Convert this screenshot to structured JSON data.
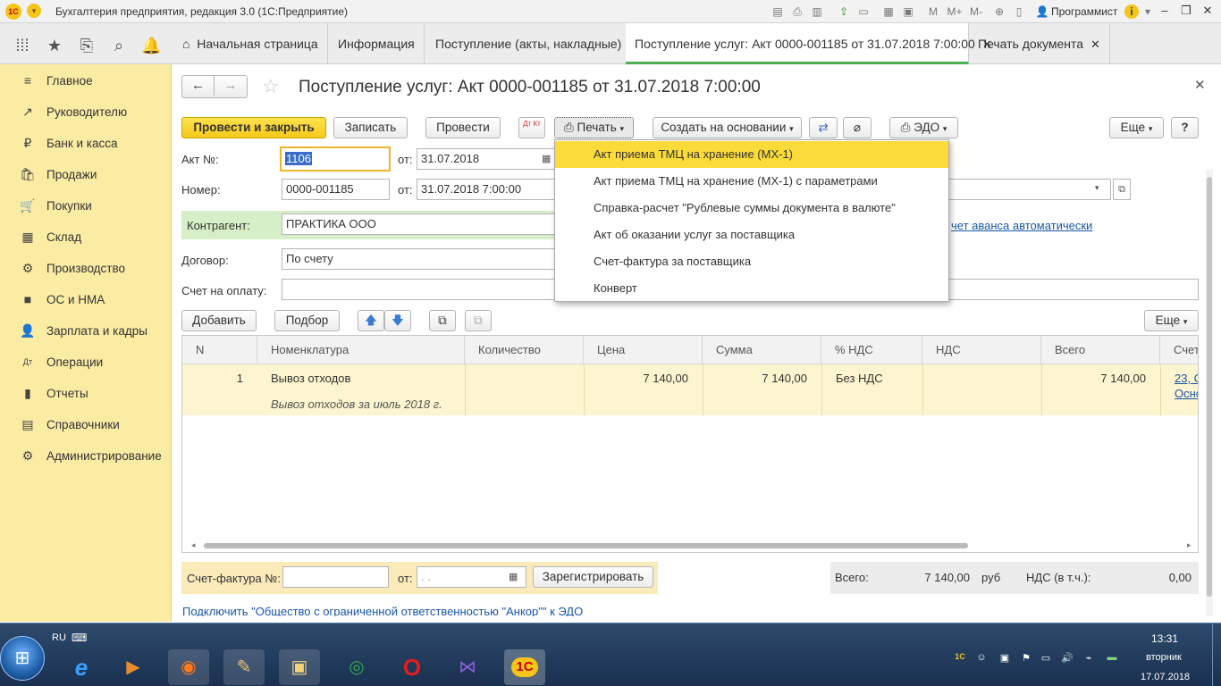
{
  "titlebar": {
    "logo": "1С",
    "title": "Бухгалтерия предприятия, редакция 3.0  (1С:Предприятие)",
    "user": "Программист",
    "calc_labels": [
      "M",
      "M+",
      "M-"
    ]
  },
  "tabs": [
    {
      "label": "Начальная страница"
    },
    {
      "label": "Информация"
    },
    {
      "label": "Поступление (акты, накладные)"
    },
    {
      "label": "Поступление услуг: Акт 0000-001185 от 31.07.2018 7:00:00"
    },
    {
      "label": "Печать документа"
    }
  ],
  "sidebar": {
    "items": [
      {
        "label": "Главное",
        "icon": "≡"
      },
      {
        "label": "Руководителю",
        "icon": "↗"
      },
      {
        "label": "Банк и касса",
        "icon": "₽"
      },
      {
        "label": "Продажи",
        "icon": "🛍"
      },
      {
        "label": "Покупки",
        "icon": "🛒"
      },
      {
        "label": "Склад",
        "icon": "▦"
      },
      {
        "label": "Производство",
        "icon": "⚙"
      },
      {
        "label": "ОС и НМА",
        "icon": "■"
      },
      {
        "label": "Зарплата и кадры",
        "icon": "👤"
      },
      {
        "label": "Операции",
        "icon": "Дт"
      },
      {
        "label": "Отчеты",
        "icon": "▮"
      },
      {
        "label": "Справочники",
        "icon": "▤"
      },
      {
        "label": "Администрирование",
        "icon": "⚙"
      }
    ]
  },
  "doc": {
    "title": "Поступление услуг: Акт 0000-001185 от 31.07.2018 7:00:00"
  },
  "toolbar": {
    "post_close": "Провести и закрыть",
    "save": "Записать",
    "post": "Провести",
    "dtkt": "Дт Кт",
    "print": "Печать",
    "create_based": "Создать на основании",
    "edo": "ЭДО",
    "more": "Еще",
    "help": "?"
  },
  "form": {
    "act_label": "Акт №:",
    "act_value": "1106",
    "from_label": "от:",
    "act_date": "31.07.2018",
    "number_label": "Номер:",
    "number_value": "0000-001185",
    "number_datetime": "31.07.2018  7:00:00",
    "contractor_label": "Контрагент:",
    "contractor_value": "ПРАКТИКА ООО",
    "contract_label": "Договор:",
    "contract_value": "По счету",
    "invoice_label": "Счет на оплату:",
    "invoice_value": "",
    "advance_link": "чет аванса автоматически"
  },
  "print_menu": {
    "items": [
      "Акт приема ТМЦ на хранение (МХ-1)",
      "Акт приема ТМЦ на хранение (МХ-1) с параметрами",
      "Справка-расчет \"Рублевые суммы документа в валюте\"",
      "Акт об оказании услуг за поставщика",
      "Счет-фактура за поставщика",
      "Конверт"
    ]
  },
  "table_toolbar": {
    "add": "Добавить",
    "pick": "Подбор",
    "more": "Еще"
  },
  "table": {
    "columns": [
      "N",
      "Номенклатура",
      "Количество",
      "Цена",
      "Сумма",
      "% НДС",
      "НДС",
      "Всего",
      "Счет"
    ],
    "rows": [
      {
        "n": "1",
        "item": "Вывоз отходов",
        "item_desc": "Вывоз отходов за июль 2018 г.",
        "qty": "",
        "price": "7 140,00",
        "sum": "7 140,00",
        "vat_rate": "Без НДС",
        "vat": "",
        "total": "7 140,00",
        "account": "23, С",
        "account2": "Осно"
      }
    ]
  },
  "footer": {
    "invoice_label": "Счет-фактура №:",
    "invoice_value": "",
    "from_label": "от:",
    "date_placeholder": " .  .",
    "register": "Зарегистрировать",
    "total_label": "Всего:",
    "total_value": "7 140,00",
    "currency": "руб",
    "vat_label": "НДС (в т.ч.):",
    "vat_value": "0,00",
    "edo_link": "Подключить \"Общество с ограниченной ответственностью \"Анкор\"\" к ЭДО"
  },
  "taskbar": {
    "lang": "RU",
    "time": "13:31",
    "weekday": "вторник",
    "date": "17.07.2018"
  }
}
